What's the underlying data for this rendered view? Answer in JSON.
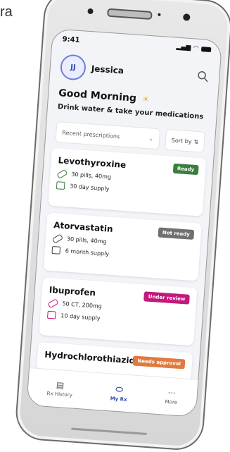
{
  "corner_text": "ra",
  "status_bar": {
    "time": "9:41"
  },
  "user": {
    "initials": "JJ",
    "name": "Jessica"
  },
  "greeting": {
    "title": "Good Morning",
    "subtitle": "Drink water & take your medications"
  },
  "filters": {
    "dropdown_label": "Recent prescriptions",
    "sort_label": "Sort by"
  },
  "prescriptions": [
    {
      "name": "Levothyroxine",
      "status": "Ready",
      "status_color": "#3b7d3d",
      "dose": "30 pills, 40mg",
      "supply": "30 day supply",
      "icon_color": "#3b7d3d"
    },
    {
      "name": "Atorvastatin",
      "status": "Not ready",
      "status_color": "#6f6f6f",
      "dose": "30 pills, 40mg",
      "supply": "6 month supply",
      "icon_color": "#444444"
    },
    {
      "name": "Ibuprofen",
      "status": "Under review",
      "status_color": "#c4187b",
      "dose": "50 CT, 200mg",
      "supply": "10 day supply",
      "icon_color": "#c4187b"
    },
    {
      "name": "Hydrochlorothiazide",
      "status": "Needs approval",
      "status_color": "#e07a3f",
      "dose": "",
      "supply": "",
      "icon_color": "#e07a3f"
    }
  ],
  "bottom_nav": [
    {
      "label": "Rx History",
      "icon": "history-icon",
      "active": false
    },
    {
      "label": "My Rx",
      "icon": "pill-icon",
      "active": true
    },
    {
      "label": "More",
      "icon": "more-icon",
      "active": false
    }
  ],
  "colors": {
    "accent": "#2f47b3",
    "sun": "#f3b324"
  }
}
